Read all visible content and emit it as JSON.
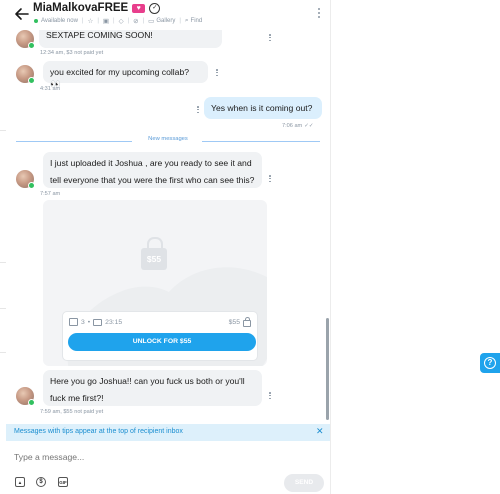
{
  "header": {
    "title": "MiaMalkovaFREE",
    "status": "Available now",
    "gallery_label": "Gallery",
    "find_label": "Find"
  },
  "messages": [
    {
      "from": "creator",
      "text": "SEXTAPE COMING SOON!",
      "meta": "12:34 am, $3 not paid yet"
    },
    {
      "from": "creator",
      "text": "you excited for my upcoming collab? 👀",
      "meta": "4:31 am"
    },
    {
      "from": "me",
      "text": "Yes when is it coming out?",
      "meta": "7:06 am"
    },
    {
      "from": "creator",
      "text_line1": "I just uploaded it Joshua , are you ready to see it and",
      "text_line2": "tell everyone that you were the first who can see this?",
      "meta": "7:57 am"
    },
    {
      "from": "creator",
      "text_line1": "Here you go Joshua!! can you fuck us both or you'll",
      "text_line2": "fuck me first?!",
      "meta": "7:59 am, $55 not paid yet"
    }
  ],
  "new_messages_label": "New messages",
  "locked_media": {
    "price_badge": "$55",
    "photo_count": "3",
    "video_duration": "23:15",
    "price": "$55",
    "unlock_label": "UNLOCK FOR $55"
  },
  "tips_notice": "Messages with tips appear at the top of recipient inbox",
  "composer": {
    "placeholder": "Type a message...",
    "gif_label": "GIF",
    "send_label": "SEND"
  },
  "colors": {
    "accent": "#1fa3ec",
    "online": "#32c05f",
    "incoming_bubble": "#f0f2f4",
    "outgoing_bubble": "#dbeffd"
  },
  "icons": [
    "back-arrow-icon",
    "heart-icon",
    "verified-icon",
    "star-icon",
    "image-icon",
    "tag-icon",
    "mute-icon",
    "gallery-icon",
    "search-icon",
    "more-icon",
    "lock-icon",
    "send-icon",
    "help-icon"
  ]
}
